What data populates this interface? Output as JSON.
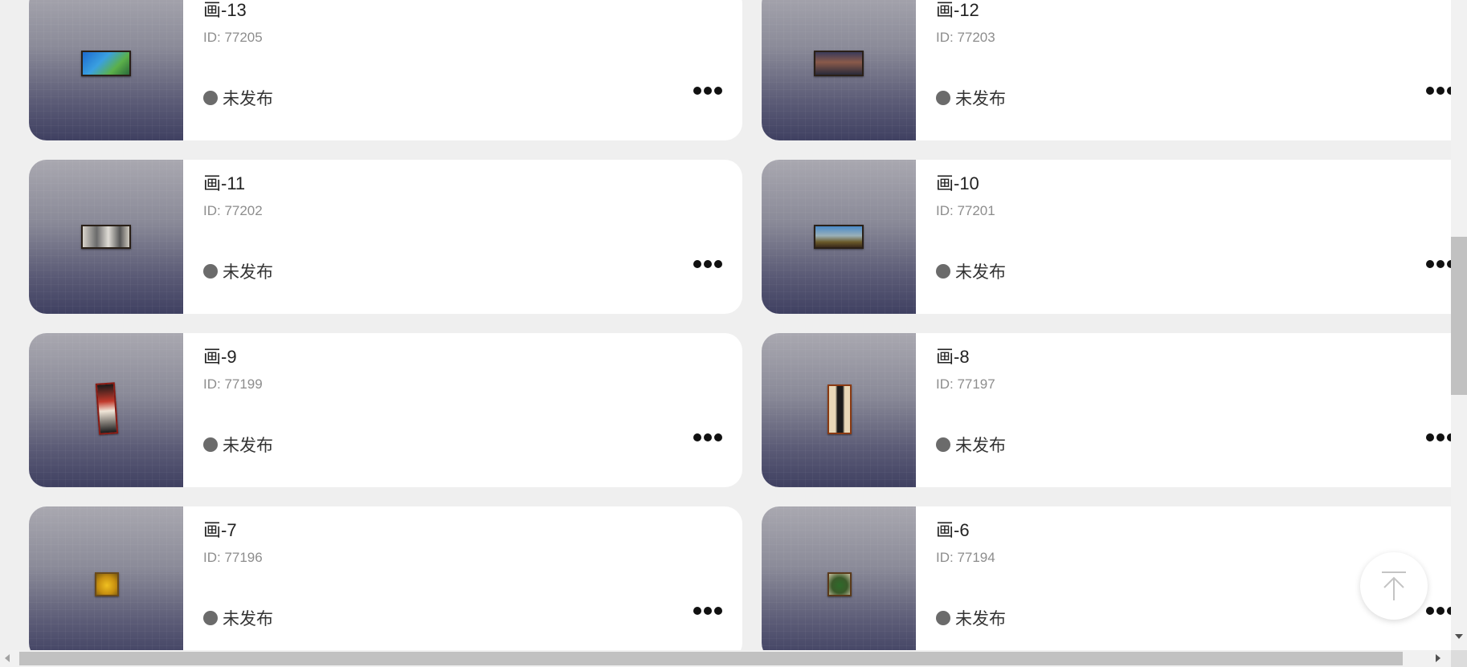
{
  "colors": {
    "accent": "#ff7a1a",
    "status_dot": "#6b6b6b",
    "page_bg": "#efefef"
  },
  "icons": {
    "more": "more-dots-icon",
    "back_to_top": "arrow-up-to-top-icon",
    "status": "status-dot-icon"
  },
  "cards": [
    {
      "title": "画-13",
      "id_text": "ID: 77205",
      "status": "未发布"
    },
    {
      "title": "画-12",
      "id_text": "ID: 77203",
      "status": "未发布"
    },
    {
      "title": "画-11",
      "id_text": "ID: 77202",
      "status": "未发布"
    },
    {
      "title": "画-10",
      "id_text": "ID: 77201",
      "status": "未发布"
    },
    {
      "title": "画-9",
      "id_text": "ID: 77199",
      "status": "未发布"
    },
    {
      "title": "画-8",
      "id_text": "ID: 77197",
      "status": "未发布"
    },
    {
      "title": "画-7",
      "id_text": "ID: 77196",
      "status": "未发布"
    },
    {
      "title": "画-6",
      "id_text": "ID: 77194",
      "status": "未发布"
    }
  ]
}
